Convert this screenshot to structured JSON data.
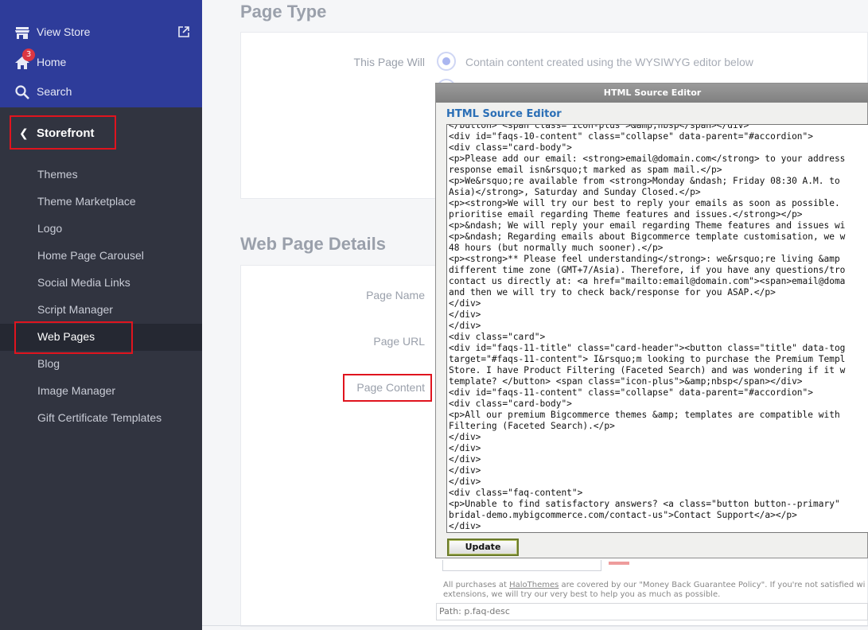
{
  "sidebar": {
    "top_items": [
      {
        "label": "View Store",
        "icon": "store-icon"
      },
      {
        "label": "Home",
        "icon": "home-icon",
        "badge": "3"
      },
      {
        "label": "Search",
        "icon": "search-icon"
      }
    ],
    "section": {
      "label": "Storefront"
    },
    "items": [
      {
        "label": "Themes"
      },
      {
        "label": "Theme Marketplace"
      },
      {
        "label": "Logo"
      },
      {
        "label": "Home Page Carousel"
      },
      {
        "label": "Social Media Links"
      },
      {
        "label": "Script Manager"
      },
      {
        "label": "Web Pages",
        "active": true
      },
      {
        "label": "Blog"
      },
      {
        "label": "Image Manager"
      },
      {
        "label": "Gift Certificate Templates"
      }
    ]
  },
  "main": {
    "page_type": {
      "title": "Page Type",
      "label": "This Page Will",
      "option": "Contain content created using the WYSIWYG editor below"
    },
    "details": {
      "title": "Web Page Details",
      "page_name_label": "Page Name",
      "page_url_label": "Page URL",
      "page_content_label": "Page Content"
    }
  },
  "editor": {
    "title": "HTML Source Editor",
    "heading": "HTML Source Editor",
    "update_label": "Update",
    "lines": [
      "</button> <span class=\"icon-plus\">&amp;nbsp</span></div>",
      "<div id=\"faqs-10-content\" class=\"collapse\" data-parent=\"#accordion\">",
      "<div class=\"card-body\">",
      "<p>Please add our email: <strong>email@domain.com</strong> to your address",
      "response email isn&rsquo;t marked as spam mail.</p>",
      "<p>We&rsquo;re available from <strong>Monday &ndash; Friday 08:30 A.M. to",
      "Asia)</strong>, Saturday and Sunday Closed.</p>",
      "<p><strong>We will try our best to reply your emails as soon as possible.",
      "prioritise email regarding Theme features and issues.</strong></p>",
      "<p>&ndash; We will reply your email regarding Theme features and issues wi",
      "<p>&ndash; Regarding emails about Bigcommerce template customisation, we w",
      "48 hours (but normally much sooner).</p>",
      "<p><strong>** Please feel understanding</strong>: we&rsquo;re living &amp",
      "different time zone (GMT+7/Asia). Therefore, if you have any questions/tro",
      "contact us directly at: <a href=\"mailto:email@domain.com\"><span>email@doma",
      "and then we will try to check back/response for you ASAP.</p>",
      "</div>",
      "</div>",
      "</div>",
      "<div class=\"card\">",
      "<div id=\"faqs-11-title\" class=\"card-header\"><button class=\"title\" data-tog",
      "target=\"#faqs-11-content\"> I&rsquo;m looking to purchase the Premium Templ",
      "Store. I have Product Filtering (Faceted Search) and was wondering if it w",
      "template? </button> <span class=\"icon-plus\">&amp;nbsp</span></div>",
      "<div id=\"faqs-11-content\" class=\"collapse\" data-parent=\"#accordion\">",
      "<div class=\"card-body\">",
      "<p>All our premium Bigcommerce themes &amp; templates are compatible with",
      "Filtering (Faceted Search).</p>",
      "</div>",
      "</div>",
      "</div>",
      "</div>",
      "</div>",
      "<div class=\"faq-content\">",
      "<p>Unable to find satisfactory answers? <a class=\"button button--primary\"",
      "bridal-demo.mybigcommerce.com/contact-us\">Contact Support</a></p>",
      "</div>"
    ]
  },
  "footer": {
    "note_line1_a": "All purchases at ",
    "note_line1_link": "HaloThemes",
    "note_line1_b": " are covered by our \"Money Back Guarantee Policy\". If you're not satisfied wi",
    "note_line2": "extensions, we will try our very best to help you as much as possible.",
    "path": "Path: p.faq-desc"
  },
  "colors": {
    "sidebar_top": "#2e3c9a",
    "sidebar": "#313440",
    "highlight": "#e0141e",
    "editor_heading": "#2b6fb6"
  }
}
